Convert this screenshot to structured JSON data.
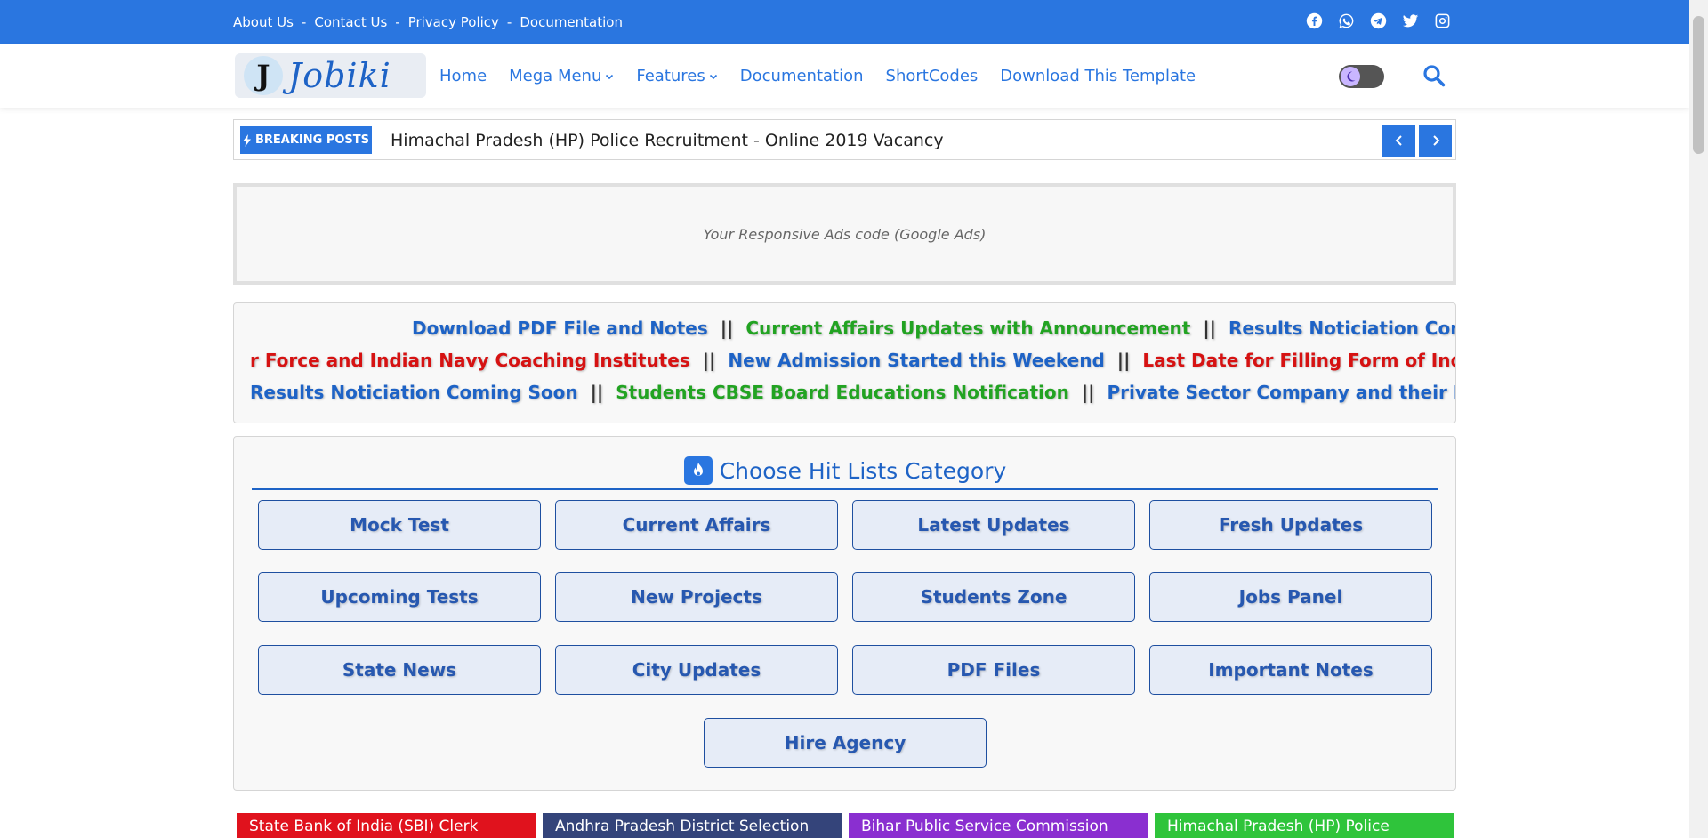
{
  "topbar": {
    "links": [
      "About Us",
      "Contact Us",
      "Privacy Policy",
      "Documentation"
    ],
    "separator": "-",
    "social_icons": [
      "facebook-icon",
      "whatsapp-icon",
      "telegram-icon",
      "twitter-icon",
      "instagram-icon"
    ]
  },
  "header": {
    "logo_mark": "J",
    "logo_text": "Jobiki",
    "nav": {
      "home": "Home",
      "mega_menu": "Mega Menu",
      "features": "Features",
      "documentation": "Documentation",
      "shortcodes": "ShortCodes",
      "download": "Download This Template"
    }
  },
  "breaking": {
    "label": "BREAKING POSTS",
    "headline": "Himachal Pradesh (HP) Police Recruitment - Online 2019 Vacancy"
  },
  "ad": {
    "text": "Your Responsive Ads code (Google Ads)"
  },
  "marquee": {
    "separator": "||",
    "line1": [
      "Download PDF File and Notes",
      "Current Affairs Updates with Announcement",
      "Results Noticiation Coming Soo"
    ],
    "line2": [
      "r Force and Indian Navy Coaching Institutes",
      "New Admission Started this Weekend",
      "Last Date for Filling Form of Indian Army"
    ],
    "line3": [
      "Results Noticiation Coming Soon",
      "Students CBSE Board Educations Notification",
      "Private Sector Company and their Resume CV"
    ]
  },
  "categories": {
    "title": "Choose Hit Lists Category",
    "items": [
      "Mock Test",
      "Current Affairs",
      "Latest Updates",
      "Fresh Updates",
      "Upcoming Tests",
      "New Projects",
      "Students Zone",
      "Jobs Panel",
      "State News",
      "City Updates",
      "PDF Files",
      "Important Notes",
      "Hire Agency"
    ]
  },
  "cards": [
    {
      "title": "State Bank of India (SBI) Clerk",
      "color": "#e0121d"
    },
    {
      "title": "Andhra Pradesh District Selection",
      "color": "#34447a"
    },
    {
      "title": "Bihar Public Service Commission",
      "color": "#8a2fd0"
    },
    {
      "title": "Himachal Pradesh (HP) Police",
      "color": "#2fc43b"
    }
  ],
  "colors": {
    "brand_blue": "#2a76e0",
    "link_blue": "#1e63c6",
    "green": "#22a322",
    "red": "#d61212"
  }
}
